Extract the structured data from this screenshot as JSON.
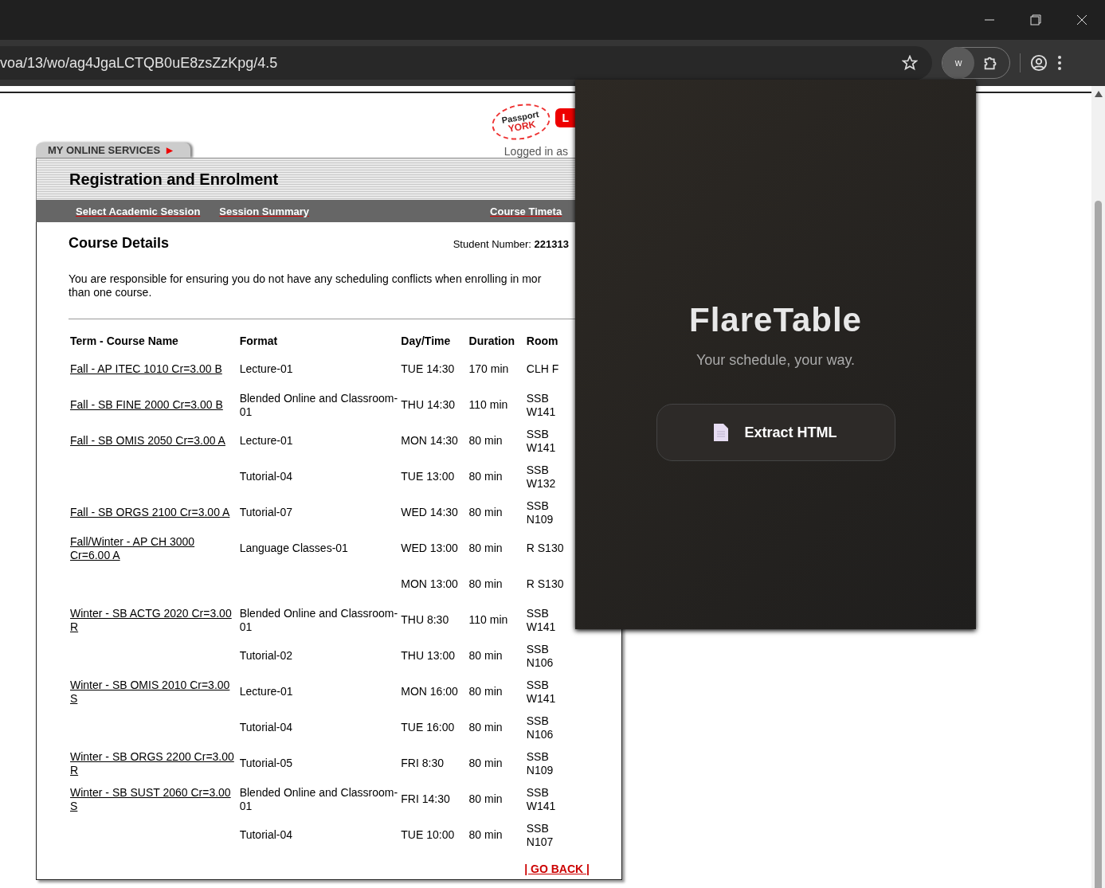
{
  "browser": {
    "url": "voa/13/wo/ag4JgaLCTQB0uE8zsZzKpg/4.5",
    "extension_letter": "w"
  },
  "site": {
    "logo_top": "Passport",
    "logo_bottom": "YORK",
    "login_button": "L",
    "logged_in": "Logged in as",
    "services_tab": "MY ONLINE SERVICES",
    "services_arrow": "▶",
    "title": "Registration and Enrolment",
    "nav": [
      {
        "label": "Select Academic Session"
      },
      {
        "label": "Session Summary"
      },
      {
        "label": "Course Timeta"
      }
    ]
  },
  "details": {
    "heading": "Course Details",
    "student_label": "Student Number:",
    "student_number": "221313",
    "note_lines": [
      "You are responsible for ensuring you do not have any scheduling conflicts when enrolling in mor",
      "than one course."
    ]
  },
  "table": {
    "columns": [
      "Term - Course Name",
      "Format",
      "Day/Time",
      "Duration",
      "Room"
    ],
    "rows": [
      {
        "course": "Fall - AP ITEC 1010 Cr=3.00 B",
        "format": "Lecture-01",
        "time": "TUE 14:30",
        "duration": "170 min",
        "room": "CLH F"
      },
      {
        "course": "Fall - SB FINE 2000 Cr=3.00 B",
        "format": "Blended Online and Classroom-01",
        "time": "THU 14:30",
        "duration": "110 min",
        "room": "SSB W141"
      },
      {
        "course": "Fall - SB OMIS 2050 Cr=3.00 A",
        "format": "Lecture-01",
        "time": "MON 14:30",
        "duration": "80 min",
        "room": "SSB W141"
      },
      {
        "format": "Tutorial-04",
        "time": "TUE 13:00",
        "duration": "80 min",
        "room": "SSB W132"
      },
      {
        "course": "Fall - SB ORGS 2100 Cr=3.00 A",
        "format": "Tutorial-07",
        "time": "WED 14:30",
        "duration": "80 min",
        "room": "SSB N109"
      },
      {
        "course": "Fall/Winter - AP CH 3000 Cr=6.00 A",
        "format": "Language Classes-01",
        "time": "WED 13:00",
        "duration": "80 min",
        "room": "R S130"
      },
      {
        "time": "MON 13:00",
        "duration": "80 min",
        "room": "R S130"
      },
      {
        "course": "Winter - SB ACTG 2020 Cr=3.00 R",
        "format": "Blended Online and Classroom-01",
        "time": "THU 8:30",
        "duration": "110 min",
        "room": "SSB W141"
      },
      {
        "format": "Tutorial-02",
        "time": "THU 13:00",
        "duration": "80 min",
        "room": "SSB N106"
      },
      {
        "course": "Winter - SB OMIS 2010 Cr=3.00 S",
        "format": "Lecture-01",
        "time": "MON 16:00",
        "duration": "80 min",
        "room": "SSB W141"
      },
      {
        "format": "Tutorial-04",
        "time": "TUE 16:00",
        "duration": "80 min",
        "room": "SSB N106"
      },
      {
        "course": "Winter - SB ORGS 2200 Cr=3.00 R",
        "format": "Tutorial-05",
        "time": "FRI 8:30",
        "duration": "80 min",
        "room": "SSB N109"
      },
      {
        "course": "Winter - SB SUST 2060 Cr=3.00 S",
        "format": "Blended Online and Classroom-01",
        "time": "FRI 14:30",
        "duration": "80 min",
        "room": "SSB W141"
      },
      {
        "format": "Tutorial-04",
        "time": "TUE 10:00",
        "duration": "80 min",
        "room": "SSB N107"
      }
    ]
  },
  "go_back": "| GO BACK |",
  "popup": {
    "title": "FlareTable",
    "tagline": "Your schedule, your way.",
    "button": "Extract HTML"
  }
}
